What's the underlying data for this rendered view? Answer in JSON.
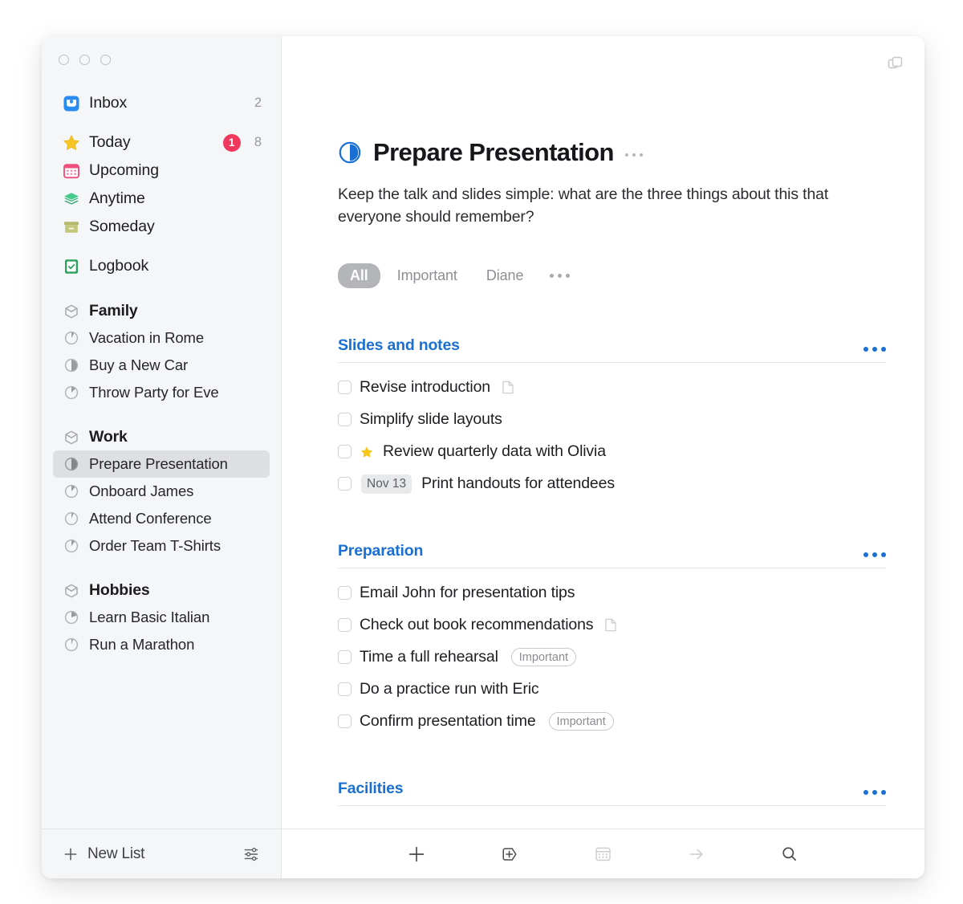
{
  "window": {
    "traffic_lights": [
      "close",
      "minimize",
      "zoom"
    ],
    "new_window_icon": "duplicate-window-icon"
  },
  "sidebar": {
    "nav": [
      {
        "label": "Inbox",
        "icon": "inbox-tray-icon",
        "count": "2",
        "badge": ""
      },
      {
        "label": "Today",
        "icon": "star-icon",
        "count": "8",
        "badge": "1"
      },
      {
        "label": "Upcoming",
        "icon": "calendar-icon",
        "count": "",
        "badge": ""
      },
      {
        "label": "Anytime",
        "icon": "layers-icon",
        "count": "",
        "badge": ""
      },
      {
        "label": "Someday",
        "icon": "archive-box-icon",
        "count": "",
        "badge": ""
      },
      {
        "label": "Logbook",
        "icon": "logbook-check-icon",
        "count": "",
        "badge": ""
      }
    ],
    "groups": [
      {
        "name": "Family",
        "projects": [
          {
            "label": "Vacation in Rome",
            "progress": 12,
            "selected": false
          },
          {
            "label": "Buy a New Car",
            "progress": 50,
            "selected": false
          },
          {
            "label": "Throw Party for Eve",
            "progress": 25,
            "selected": false
          }
        ]
      },
      {
        "name": "Work",
        "projects": [
          {
            "label": "Prepare Presentation",
            "progress": 50,
            "selected": true
          },
          {
            "label": "Onboard James",
            "progress": 22,
            "selected": false
          },
          {
            "label": "Attend Conference",
            "progress": 10,
            "selected": false
          },
          {
            "label": "Order Team T-Shirts",
            "progress": 20,
            "selected": false
          }
        ]
      },
      {
        "name": "Hobbies",
        "projects": [
          {
            "label": "Learn Basic Italian",
            "progress": 40,
            "selected": false
          },
          {
            "label": "Run a Marathon",
            "progress": 8,
            "selected": false
          }
        ]
      }
    ]
  },
  "main": {
    "title": "Prepare Presentation",
    "title_progress": 50,
    "description": "Keep the talk and slides simple: what are the three things about this that everyone should remember?",
    "filters": [
      {
        "label": "All",
        "active": true
      },
      {
        "label": "Important",
        "active": false
      },
      {
        "label": "Diane",
        "active": false
      }
    ],
    "sections": [
      {
        "title": "Slides and notes",
        "todos": [
          {
            "text": "Revise introduction",
            "note": true,
            "star": false,
            "tag": "",
            "date": ""
          },
          {
            "text": "Simplify slide layouts",
            "note": false,
            "star": false,
            "tag": "",
            "date": ""
          },
          {
            "text": "Review quarterly data with Olivia",
            "note": false,
            "star": true,
            "tag": "",
            "date": ""
          },
          {
            "text": "Print handouts for attendees",
            "note": false,
            "star": false,
            "tag": "",
            "date": "Nov 13"
          }
        ]
      },
      {
        "title": "Preparation",
        "todos": [
          {
            "text": "Email John for presentation tips",
            "note": false,
            "star": false,
            "tag": "",
            "date": ""
          },
          {
            "text": "Check out book recommendations",
            "note": true,
            "star": false,
            "tag": "",
            "date": ""
          },
          {
            "text": "Time a full rehearsal",
            "note": false,
            "star": false,
            "tag": "Important",
            "date": ""
          },
          {
            "text": "Do a practice run with Eric",
            "note": false,
            "star": false,
            "tag": "",
            "date": ""
          },
          {
            "text": "Confirm presentation time",
            "note": false,
            "star": false,
            "tag": "Important",
            "date": ""
          }
        ]
      },
      {
        "title": "Facilities",
        "todos": []
      }
    ]
  },
  "toolbar": {
    "new_list_label": "New List",
    "left_icons": [
      "plus-icon",
      "sliders-settings-icon"
    ],
    "right_icons": [
      "plus-icon",
      "new-heading-tag-icon",
      "calendar-icon",
      "move-arrow-icon",
      "search-icon"
    ]
  },
  "colors": {
    "accent_blue": "#1a6fd4",
    "section_blue": "#1a6fd0",
    "badge_red": "#f0385c",
    "star_yellow": "#f5c518",
    "sidebar_bg": "#f5f6f7",
    "selected_bg": "#dedfe1"
  }
}
